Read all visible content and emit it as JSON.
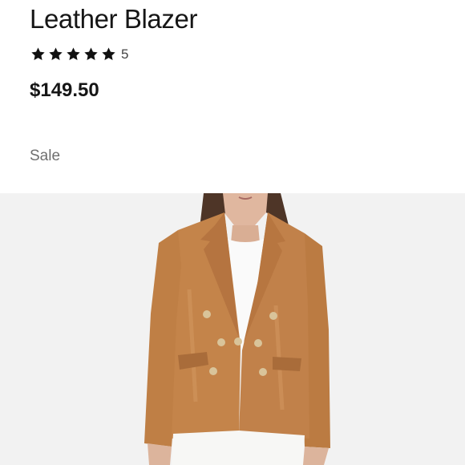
{
  "product": {
    "title": "Leather Blazer",
    "rating": {
      "stars": 5,
      "max_stars": 5,
      "count": "5"
    },
    "price": "$149.50",
    "badge": "Sale"
  },
  "image": {
    "subject": "product-photo-leather-blazer",
    "background_color": "#f2f2f2",
    "jacket_color": "#c4844a"
  },
  "icons": {
    "star": "star-icon"
  }
}
